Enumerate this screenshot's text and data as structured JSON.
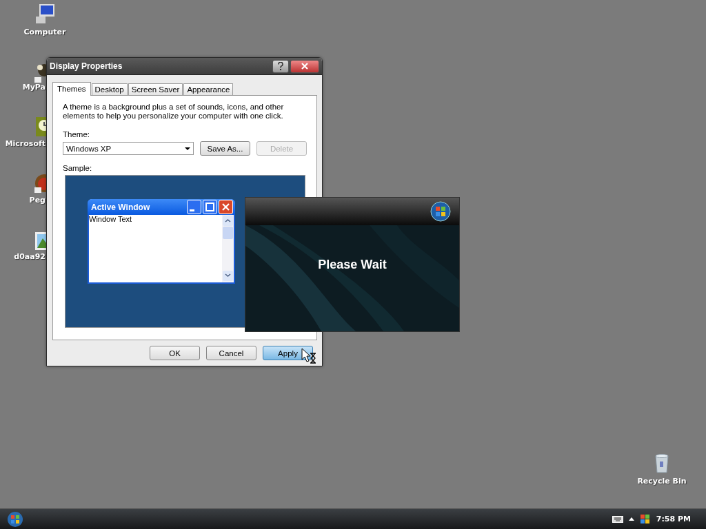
{
  "desktop_icons": [
    {
      "label": "Computer",
      "kind": "computer"
    },
    {
      "label": "MyPa",
      "kind": "figure"
    },
    {
      "label": "Microsoft",
      "kind": "clock"
    },
    {
      "label": "Peg",
      "kind": "ball"
    },
    {
      "label": "d0aa92",
      "kind": "image"
    },
    {
      "label": "Recycle Bin",
      "kind": "bin"
    }
  ],
  "dialog": {
    "title": "Display Properties",
    "tabs": [
      {
        "label": "Themes",
        "selected": true
      },
      {
        "label": "Desktop",
        "selected": false
      },
      {
        "label": "Screen Saver",
        "selected": false
      },
      {
        "label": "Appearance",
        "selected": false
      }
    ],
    "description": "A theme is a background plus a set of sounds, icons, and other elements to help you personalize your computer with one click.",
    "theme_label": "Theme:",
    "theme_value": "Windows XP",
    "theme_buttons": [
      {
        "label": "Save As...",
        "disabled": false
      },
      {
        "label": "Delete",
        "disabled": true
      }
    ],
    "sample_label": "Sample:",
    "sample": {
      "title": "Active Window",
      "text": "Window Text"
    },
    "buttons": [
      {
        "label": "OK",
        "focused": false
      },
      {
        "label": "Cancel",
        "focused": false
      },
      {
        "label": "Apply",
        "focused": true
      }
    ]
  },
  "splash": {
    "text": "Please Wait"
  },
  "taskbar": {
    "clock": "7:58 PM"
  }
}
